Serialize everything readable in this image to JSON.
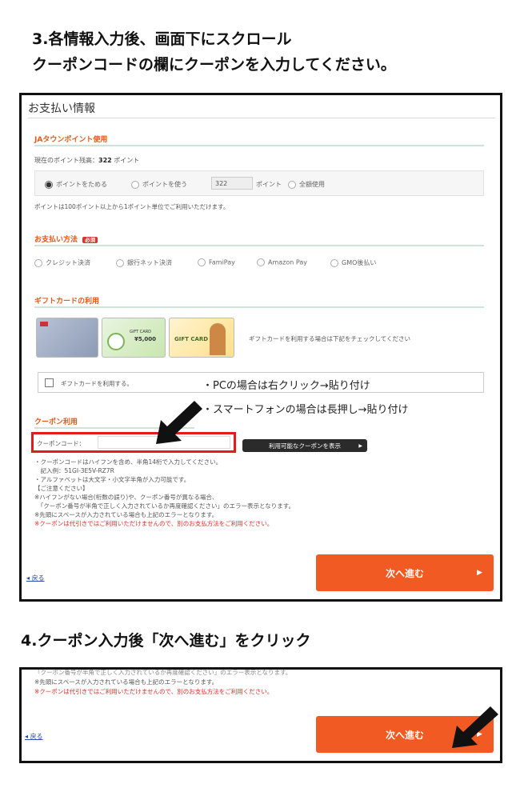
{
  "instructions": {
    "step3_line1": "3.各情報入力後、画面下にスクロール",
    "step3_line2": "クーポンコードの欄にクーポンを入力してください。",
    "step4": "4.クーポン入力後「次へ進む」をクリック",
    "tip_pc": "・PCの場合は右クリック→貼り付け",
    "tip_sp": "・スマートフォンの場合は長押し→貼り付け"
  },
  "payment": {
    "title": "お支払い情報",
    "ja_town": {
      "title": "JAタウンポイント使用",
      "balance_label": "現在のポイント残高：",
      "balance_value": "322",
      "balance_unit": "ポイント",
      "opt_save": "ポイントをためる",
      "opt_use": "ポイントを使う",
      "use_amount": "322",
      "use_unit": "ポイント",
      "opt_all": "全額使用",
      "note": "ポイントは100ポイント以上から1ポイント単位でご利用いただけます。"
    },
    "method": {
      "title": "お支払い方法",
      "required_badge": "必須",
      "options": [
        "クレジット決済",
        "銀行ネット決済",
        "FamiPay",
        "Amazon Pay",
        "GMO後払い"
      ]
    },
    "gift": {
      "title": "ギフトカードの利用",
      "card_labels": [
        "GIFT CARD",
        "¥5,000",
        "GIFT CARD"
      ],
      "notice": "ギフトカードを利用する場合は下記をチェックしてください",
      "checkbox_label": "ギフトカードを利用する。"
    },
    "coupon": {
      "title": "クーポン利用",
      "code_label": "クーポンコード：",
      "code_value": "",
      "show_button": "利用可能なクーポンを表示",
      "notes": [
        "・クーポンコードはハイフンを含め、半角14桁で入力してください。",
        "　記入例：51GI-3E5V-RZ7R",
        "・アルファベットは大文字・小文字半角が入力可能です。",
        "【ご注意ください】",
        "※ハイフンがない場合(桁数の誤り)や、クーポン番号が異なる場合、",
        "　「クーポン番号が半角で正しく入力されているか再度確認ください」のエラー表示となります。",
        "※先頭にスペースが入力されている場合も上記のエラーとなります。"
      ],
      "warning": "※クーポンは代引きではご利用いただけませんので、別のお支払方法をご利用ください。"
    },
    "back_link": "戻る",
    "next_button": "次へ進む"
  },
  "zoom": {
    "note_partial": "「クーポン番号が半角で正しく入力されているか再度確認ください」のエラー表示となります。",
    "note_space": "※先頭にスペースが入力されている場合も上記のエラーとなります。",
    "warning": "※クーポンは代引きではご利用いただけませんので、別のお支払方法をご利用ください。",
    "back_link": "戻る",
    "next_button": "次へ進む"
  },
  "colors": {
    "accent": "#f15a22",
    "section_title": "#e05a1a",
    "highlight_box": "#e21b1b",
    "warning_text": "#e0302a"
  }
}
